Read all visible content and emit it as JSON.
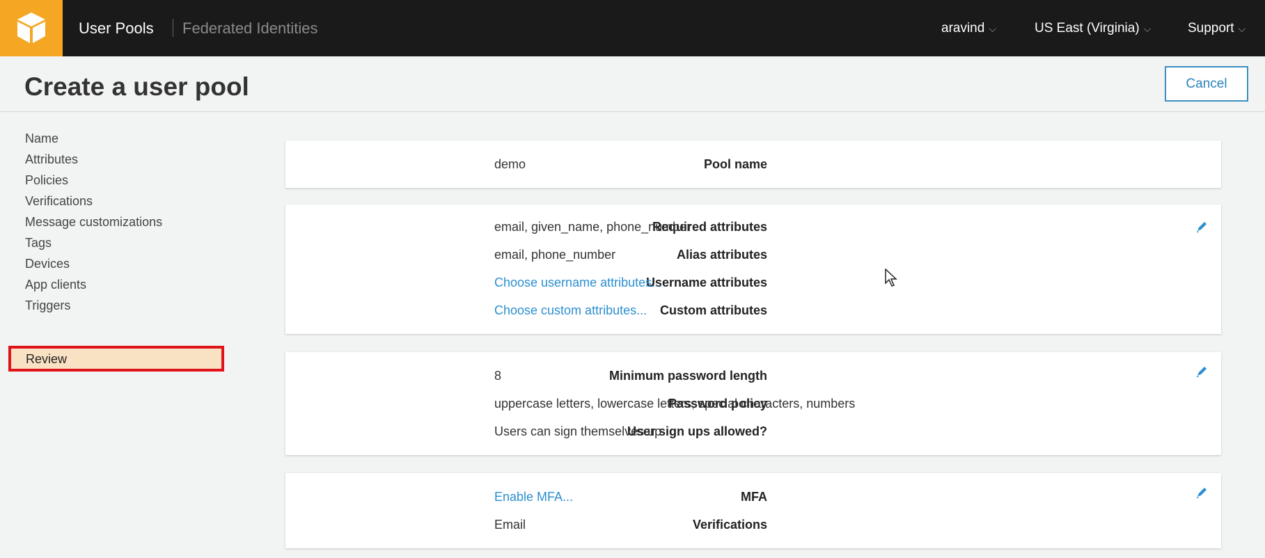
{
  "topbar": {
    "logo": "aws-cube-logo",
    "nav_active": "User Pools",
    "nav_inactive": "Federated Identities",
    "user_menu": "aravind",
    "region_menu": "US East (Virginia)",
    "support_menu": "Support",
    "chevron": "⌵"
  },
  "header": {
    "title": "Create a user pool",
    "cancel_label": "Cancel"
  },
  "sidebar": {
    "items": [
      {
        "label": "Name"
      },
      {
        "label": "Attributes"
      },
      {
        "label": "Policies"
      },
      {
        "label": "Verifications"
      },
      {
        "label": "Message customizations"
      },
      {
        "label": "Tags"
      },
      {
        "label": "Devices"
      },
      {
        "label": "App clients"
      },
      {
        "label": "Triggers"
      },
      {
        "label": "Review"
      }
    ],
    "selected": "Review"
  },
  "sections": {
    "pool": {
      "pool_name_label": "Pool name",
      "pool_name_value": "demo"
    },
    "attributes": {
      "required_label": "Required attributes",
      "required_value": "email, given_name, phone_number",
      "alias_label": "Alias attributes",
      "alias_value": "email, phone_number",
      "username_label": "Username attributes",
      "username_value": "Choose username attributes...",
      "custom_label": "Custom attributes",
      "custom_value": "Choose custom attributes..."
    },
    "policies": {
      "min_len_label": "Minimum password length",
      "min_len_value": "8",
      "policy_label": "Password policy",
      "policy_value": "uppercase letters, lowercase letters, special characters, numbers",
      "signup_label": "User sign ups allowed?",
      "signup_value": "Users can sign themselves up"
    },
    "mfa": {
      "mfa_label": "MFA",
      "mfa_value": "Enable MFA...",
      "verif_label": "Verifications",
      "verif_value": "Email"
    }
  },
  "colors": {
    "accent": "#2b8fd0",
    "logo": "#f5a623",
    "topbar": "#1a1a1a",
    "selected_bg": "#f9e2c3",
    "selected_border": "#e0131a"
  },
  "icons": {
    "edit": "pencil-icon",
    "cursor": "mouse-pointer-icon"
  }
}
